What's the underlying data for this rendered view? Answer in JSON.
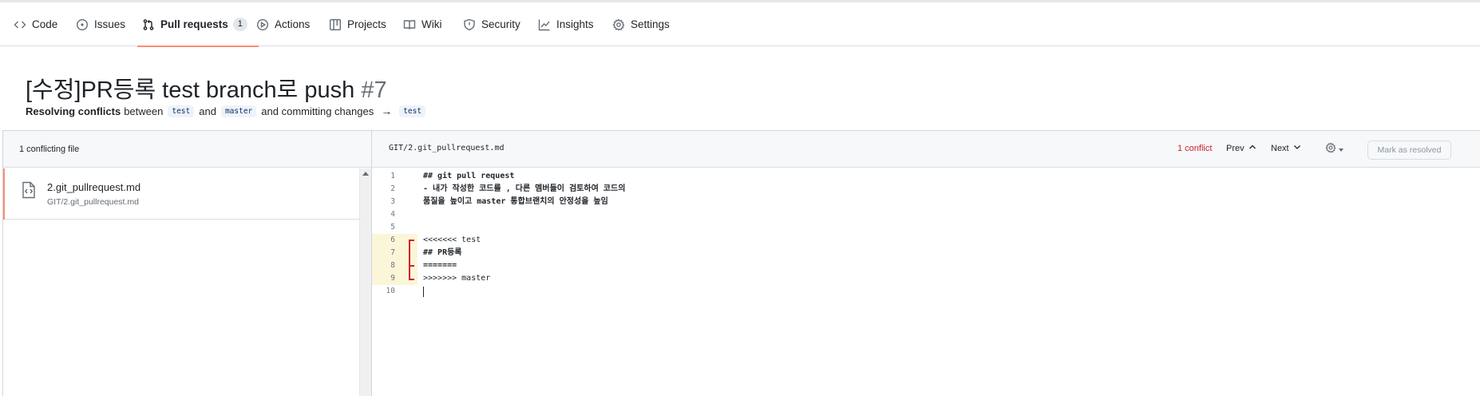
{
  "nav": {
    "items": [
      {
        "label": "Code",
        "icon": "code-icon"
      },
      {
        "label": "Issues",
        "icon": "issue-icon"
      },
      {
        "label": "Pull requests",
        "icon": "git-pull-request-icon",
        "count": "1",
        "active": true
      },
      {
        "label": "Actions",
        "icon": "play-icon"
      },
      {
        "label": "Projects",
        "icon": "table-icon"
      },
      {
        "label": "Wiki",
        "icon": "book-icon"
      },
      {
        "label": "Security",
        "icon": "shield-icon"
      },
      {
        "label": "Insights",
        "icon": "graph-icon"
      },
      {
        "label": "Settings",
        "icon": "gear-icon"
      }
    ]
  },
  "pr": {
    "title": "[수정]PR등록 test branch로 push",
    "number": "#7",
    "subtitle_bold": "Resolving conflicts",
    "subtitle_between": "between",
    "branch_head": "test",
    "subtitle_and": "and",
    "branch_base": "master",
    "subtitle_committing": "and committing changes",
    "arrow": "→",
    "branch_target": "test"
  },
  "left": {
    "header": "1 conflicting file",
    "file_name": "2.git_pullrequest.md",
    "file_path": "GIT/2.git_pullrequest.md"
  },
  "right": {
    "file_title": "GIT/2.git_pullrequest.md",
    "conflict_count": "1 conflict",
    "prev_label": "Prev",
    "next_label": "Next",
    "resolve_label": "Mark as resolved"
  },
  "editor": {
    "lines": [
      {
        "n": "1",
        "text": "## git pull request"
      },
      {
        "n": "2",
        "text": "- 내가 작성한 코드를 , 다른 멤버들이 검토하여 코드의"
      },
      {
        "n": "3",
        "text": "품질을 높이고 master 통합브랜치의 안정성을 높임"
      },
      {
        "n": "4",
        "text": ""
      },
      {
        "n": "5",
        "text": ""
      },
      {
        "n": "6",
        "text": "<<<<<<< test"
      },
      {
        "n": "7",
        "text": "## PR등록"
      },
      {
        "n": "8",
        "text": "======="
      },
      {
        "n": "9",
        "text": ">>>>>>> master"
      },
      {
        "n": "10",
        "text": ""
      }
    ]
  },
  "colors": {
    "accent_underline": "#fd8c73",
    "conflict_red": "#cf222e",
    "conflict_bg": "#fbf6d8"
  }
}
